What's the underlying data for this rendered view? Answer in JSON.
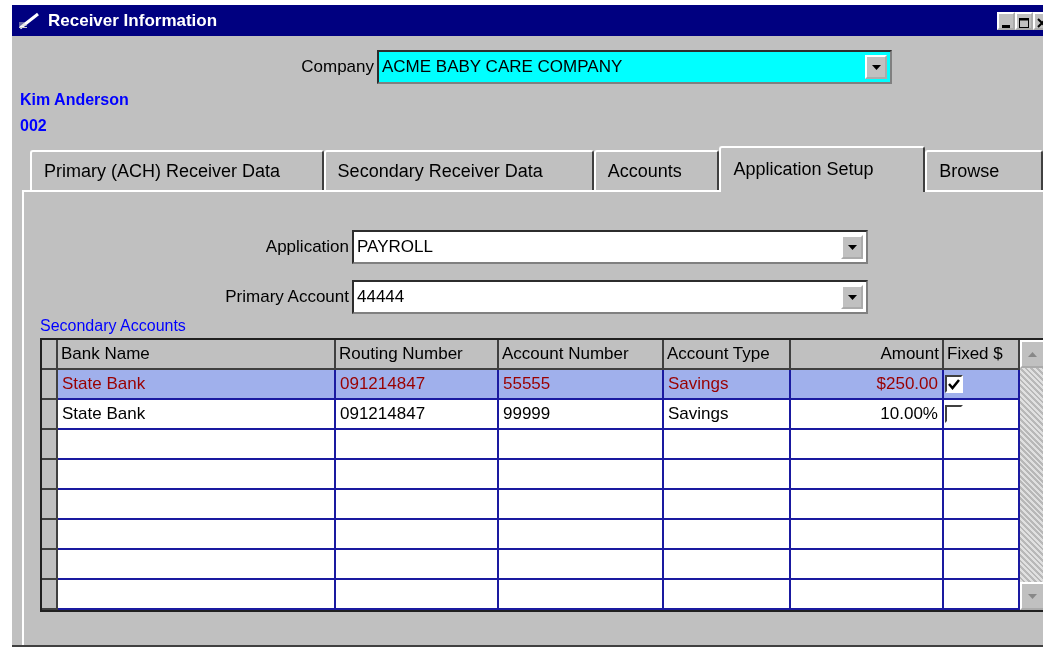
{
  "window": {
    "title": "Receiver Information"
  },
  "company": {
    "label": "Company",
    "value": "ACME BABY CARE COMPANY"
  },
  "receiver": {
    "name": "Kim Anderson",
    "number": "002"
  },
  "tabs": [
    {
      "label": "Primary (ACH) Receiver Data",
      "selected": false
    },
    {
      "label": "Secondary Receiver Data",
      "selected": false
    },
    {
      "label": "Accounts",
      "selected": false
    },
    {
      "label": "Application Setup",
      "selected": true
    },
    {
      "label": "Browse",
      "selected": false
    }
  ],
  "application": {
    "label": "Application",
    "value": "PAYROLL"
  },
  "primary_account": {
    "label": "Primary Account",
    "value": "44444"
  },
  "secondary_accounts": {
    "title": "Secondary Accounts",
    "columns": [
      "Bank Name",
      "Routing Number",
      "Account Number",
      "Account Type",
      "Amount",
      "Fixed $"
    ],
    "rows": [
      {
        "selected": true,
        "cells": [
          "State Bank",
          "091214847",
          "55555",
          "Savings",
          "$250.00"
        ],
        "checked": true
      },
      {
        "selected": false,
        "cells": [
          "State Bank",
          "091214847",
          "99999",
          "Savings",
          "10.00%"
        ],
        "checked": false
      },
      {
        "selected": false
      },
      {
        "selected": false
      },
      {
        "selected": false
      },
      {
        "selected": false
      },
      {
        "selected": false
      },
      {
        "selected": false
      }
    ]
  }
}
